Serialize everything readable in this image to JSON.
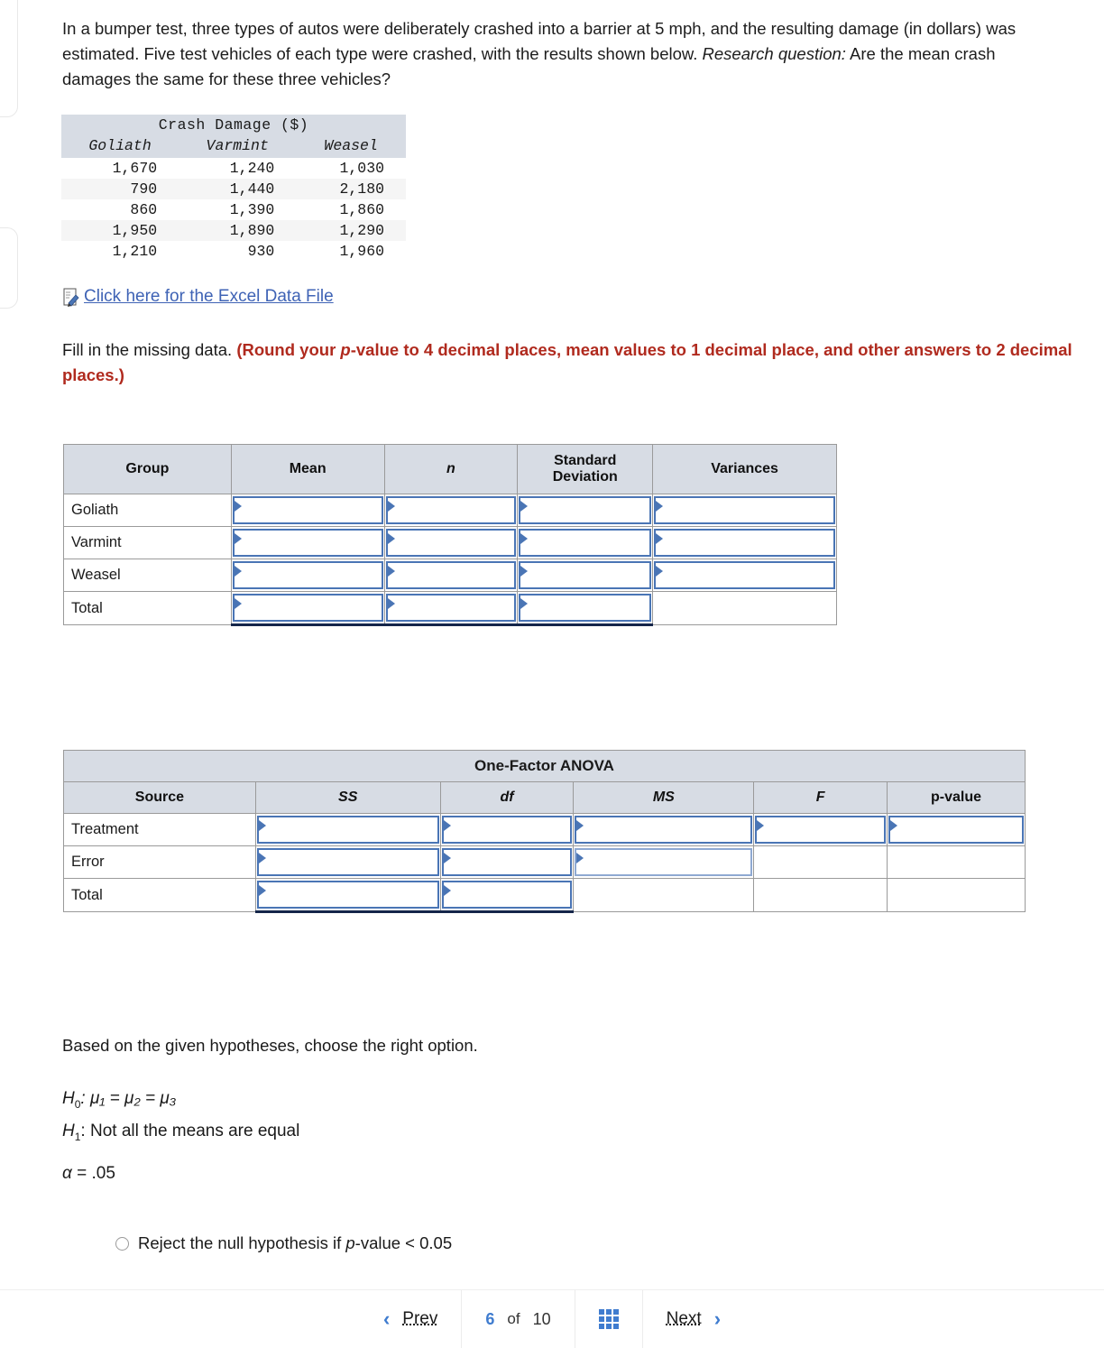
{
  "intro": {
    "part1": "In a bumper test, three types of autos were deliberately crashed into a barrier at 5 mph, and the resulting damage (in dollars) was estimated. Five test vehicles of each type were crashed, with the results shown below. ",
    "italic": "Research question:",
    "part2": " Are the mean crash damages the same for these three vehicles?"
  },
  "crash_table": {
    "title": "Crash Damage ($)",
    "columns": [
      "Goliath",
      "Varmint",
      "Weasel"
    ],
    "rows": [
      [
        "1,670",
        "1,240",
        "1,030"
      ],
      [
        "790",
        "1,440",
        "2,180"
      ],
      [
        "860",
        "1,390",
        "1,860"
      ],
      [
        "1,950",
        "1,890",
        "1,290"
      ],
      [
        "1,210",
        "930",
        "1,960"
      ]
    ]
  },
  "excel_link": {
    "icon": "excel-document-icon",
    "label": "Click here for the Excel Data File"
  },
  "instruction": {
    "lead": "Fill in the missing data. ",
    "bold_part1": "(Round your ",
    "bold_italic": "p",
    "bold_part2": "-value to 4 decimal places, mean values to 1 decimal place, and other answers to 2 decimal places.)"
  },
  "summary_table": {
    "headers": {
      "group": "Group",
      "mean": "Mean",
      "n": "n",
      "sd": "Standard Deviation",
      "variances": "Variances"
    },
    "rows": [
      {
        "label": "Goliath",
        "mean": "",
        "n": "",
        "sd": "",
        "variances": ""
      },
      {
        "label": "Varmint",
        "mean": "",
        "n": "",
        "sd": "",
        "variances": ""
      },
      {
        "label": "Weasel",
        "mean": "",
        "n": "",
        "sd": "",
        "variances": ""
      },
      {
        "label": "Total",
        "mean": "",
        "n": "",
        "sd": "",
        "variances": null
      }
    ]
  },
  "anova_table": {
    "title": "One-Factor ANOVA",
    "headers": {
      "source": "Source",
      "ss": "SS",
      "df": "df",
      "ms": "MS",
      "f": "F",
      "p": "p-value"
    },
    "rows": [
      {
        "label": "Treatment",
        "ss": "",
        "df": "",
        "ms": "",
        "f": "",
        "p": ""
      },
      {
        "label": "Error",
        "ss": "",
        "df": "",
        "ms": "",
        "f": null,
        "p": null
      },
      {
        "label": "Total",
        "ss": "",
        "df": "",
        "ms": null,
        "f": null,
        "p": null
      }
    ]
  },
  "hypotheses": {
    "lead": "Based on the given hypotheses, choose the right option.",
    "h0_label": "H",
    "h0_sub": "0",
    "h0_text": ": μ₁ = μ₂ = μ₃",
    "h1_label": "H",
    "h1_sub": "1",
    "h1_text": ": Not all the means are equal",
    "alpha_symbol": "α",
    "alpha_value": " = .05"
  },
  "options": [
    {
      "text_before": "Reject the null hypothesis if ",
      "italic": "p",
      "text_after": "-value < 0.05"
    }
  ],
  "footer": {
    "prev_label": "Prev",
    "prev_icon": "chevron-left-icon",
    "current_page": "6",
    "of_label": "of",
    "total_pages": "10",
    "grid_icon": "grid-menu-icon",
    "next_label": "Next",
    "next_icon": "chevron-right-icon"
  },
  "colors": {
    "header_bg": "#d7dce4",
    "input_border": "#4a75b5",
    "link": "#3f63b5",
    "accent": "#3f7ccf",
    "red": "#b02a1e"
  }
}
